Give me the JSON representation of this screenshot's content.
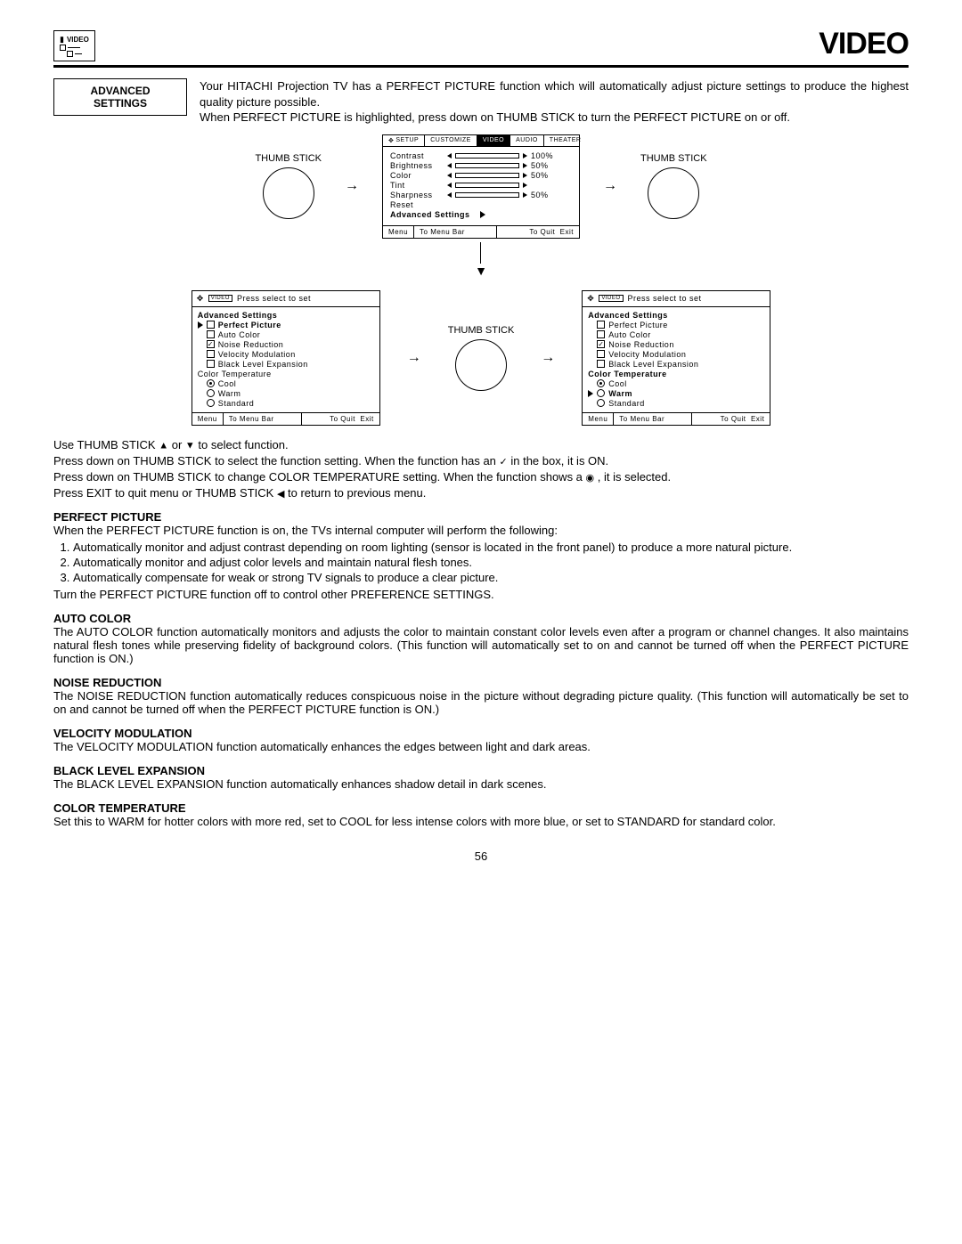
{
  "header": {
    "icon_label": "VIDEO",
    "title": "VIDEO"
  },
  "side_label": "ADVANCED SETTINGS",
  "intro": {
    "p1": "Your HITACHI Projection TV has a PERFECT PICTURE function which will automatically adjust picture settings to produce the highest quality picture possible.",
    "p2": "When PERFECT PICTURE is highlighted, press down on THUMB STICK to turn the PERFECT PICTURE on or off."
  },
  "thumb_label": "THUMB STICK",
  "osd": {
    "tabs": [
      "SETUP",
      "CUSTOMIZE",
      "VIDEO",
      "AUDIO",
      "THEATER"
    ],
    "sliders": [
      {
        "name": "Contrast",
        "val": "100%"
      },
      {
        "name": "Brightness",
        "val": "50%"
      },
      {
        "name": "Color",
        "val": "50%"
      },
      {
        "name": "Tint",
        "val": ""
      },
      {
        "name": "Sharpness",
        "val": "50%"
      }
    ],
    "reset": "Reset",
    "adv": "Advanced Settings",
    "foot": {
      "menu": "Menu",
      "bar": "To Menu Bar",
      "quit": "To Quit",
      "exit": "Exit"
    }
  },
  "adv_panel": {
    "hdr": "Press select to set",
    "title": "Advanced Settings",
    "items": [
      {
        "label": "Perfect Picture"
      },
      {
        "label": "Auto Color"
      },
      {
        "label": "Noise Reduction"
      },
      {
        "label": "Velocity Modulation"
      },
      {
        "label": "Black Level Expansion"
      }
    ],
    "ct_title": "Color Temperature",
    "ct": [
      "Cool",
      "Warm",
      "Standard"
    ],
    "foot": {
      "menu": "Menu",
      "bar": "To Menu Bar",
      "quit": "To Quit",
      "exit": "Exit"
    }
  },
  "instructions": {
    "l1a": "Use THUMB STICK ",
    "l1b": " or ",
    "l1c": " to select function.",
    "l2a": "Press down on THUMB STICK to select the function setting. When the function has an ",
    "l2b": " in the box, it is ON.",
    "l3a": "Press down on THUMB STICK to change COLOR TEMPERATURE setting.  When the function shows a ",
    "l3b": " , it is selected.",
    "l4a": "Press EXIT to quit menu or THUMB STICK ",
    "l4b": " to return to previous menu."
  },
  "sections": {
    "pp_title": "PERFECT PICTURE",
    "pp_lead": "When the PERFECT PICTURE function is on, the TVs  internal computer will perform the following:",
    "pp_1": "Automatically monitor and adjust contrast depending on room lighting (sensor is located in the front panel) to produce a more natural picture.",
    "pp_2": "Automatically monitor and adjust color levels and maintain natural flesh tones.",
    "pp_3": "Automatically compensate for weak or strong TV signals to produce a clear picture.",
    "pp_after": "Turn the PERFECT PICTURE function off to control other PREFERENCE SETTINGS.",
    "ac_title": "AUTO COLOR",
    "ac": "The AUTO COLOR function automatically monitors and adjusts the color to maintain constant color levels even after a program or channel changes. It also maintains natural flesh tones while preserving fidelity of background colors. (This function will automatically set to on and cannot be turned off when the PERFECT PICTURE function is ON.)",
    "nr_title": "NOISE REDUCTION",
    "nr": "The NOISE REDUCTION function automatically reduces conspicuous noise in the picture without degrading picture quality. (This function will automatically be set to on and cannot be turned off when the PERFECT PICTURE function is ON.)",
    "vm_title": "VELOCITY MODULATION",
    "vm": "The VELOCITY MODULATION function automatically enhances the edges between light and dark areas.",
    "ble_title": "BLACK LEVEL EXPANSION",
    "ble": "The BLACK LEVEL EXPANSION function automatically enhances shadow detail in dark scenes.",
    "ct_title": "COLOR TEMPERATURE",
    "ct": "Set this to WARM for hotter colors with more red, set to COOL for less intense colors with more blue, or set to STANDARD for standard color."
  },
  "page": "56"
}
